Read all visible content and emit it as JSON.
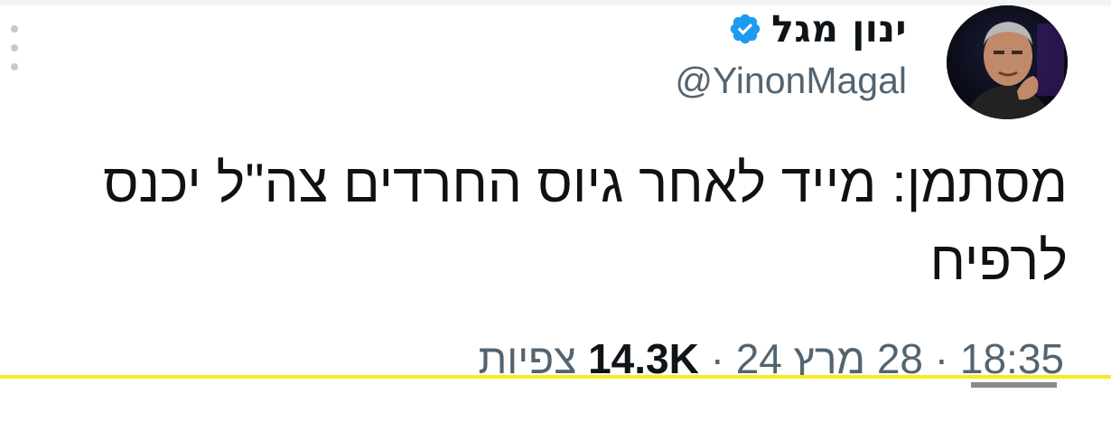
{
  "author": {
    "name": "ינון מגל",
    "handle": "@YinonMagal",
    "verified": true
  },
  "tweet": {
    "text": "מסתמן: מייד לאחר גיוס החרדים צה\"ל יכנס לרפיח"
  },
  "meta": {
    "time": "18:35",
    "separator": "·",
    "date": "28 מרץ 24",
    "views_count": "14.3K",
    "views_label": "צפיות"
  },
  "icons": {
    "more": "more-vertical-icon",
    "verified": "verified-badge-icon"
  },
  "colors": {
    "verified": "#1d9bf0",
    "secondary_text": "#536471",
    "highlight_line": "#f7ec1e"
  }
}
